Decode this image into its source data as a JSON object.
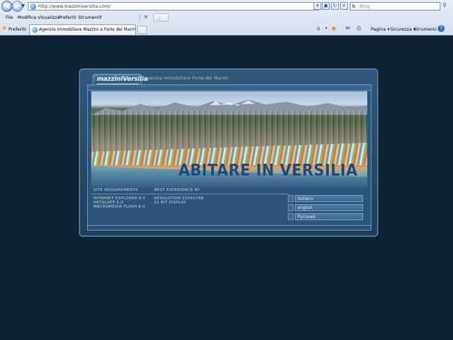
{
  "browser": {
    "url": "http://www.mazziniversilia.com/",
    "search_placeholder": "Bing",
    "search_engine_glyph": "b",
    "menu": [
      "File",
      "Modifica",
      "Visualizza",
      "Preferiti",
      "Strumenti",
      "?"
    ],
    "favorites_label": "Preferiti",
    "tab_title": "Agenzia Immobiliare Mazzini a Forte dei Marmi, Versilia...",
    "commands": {
      "pagina": "Pagina",
      "sicurezza": "Sicurezza",
      "strumenti": "Strumenti"
    }
  },
  "site": {
    "logo_text": "mazziniVersilia",
    "tagline": "agenzia immobiliare Forte dei Marmi",
    "headline": "ABITARE IN VERSILIA",
    "requirements": {
      "heading": "SITE REQUIREMENTS",
      "lines": [
        "INTERNET EXPLORER 6.0",
        "NETSCAPE 6.0",
        "MACROMEDIA FLASH 6.0"
      ]
    },
    "experience": {
      "heading": "BEST EXPERIENCE BY",
      "lines": [
        "RESOLUTION 1024X768",
        "32 BIT DISPLAY"
      ]
    },
    "languages": [
      "italiano",
      "english",
      "Русский"
    ]
  },
  "colors": {
    "page_background": "#0f2233",
    "frame": "#30597c",
    "headline": "#1f4a78"
  }
}
